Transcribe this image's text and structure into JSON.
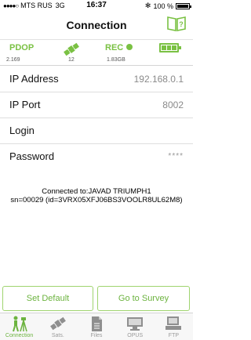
{
  "status_bar": {
    "carrier": "MTS RUS",
    "network": "3G",
    "time": "16:37",
    "battery": "100 %"
  },
  "nav": {
    "title": "Connection",
    "help_icon": "help-book-icon"
  },
  "gnss": {
    "pdop_label": "PDOP",
    "pdop_value": "2.169",
    "sats_value": "12",
    "rec_label": "REC",
    "rec_value": "1.83GB",
    "accent_color": "#7ac143"
  },
  "form": {
    "ip_address_label": "IP Address",
    "ip_address_value": "192.168.0.1",
    "ip_port_label": "IP Port",
    "ip_port_value": "8002",
    "login_label": "Login",
    "login_value": "",
    "password_label": "Password",
    "password_value": "****"
  },
  "connection": {
    "line1": "Connected to:JAVAD TRIUMPH1",
    "line2": "sn=00029 (id=3VRX05XFJ06BS3VOOLR8UL62M8)"
  },
  "buttons": {
    "set_default": "Set Default",
    "go_to_survey": "Go to Survey"
  },
  "tabs": [
    {
      "label": "Connection",
      "icon": "surveyor-tripod-icon",
      "active": true
    },
    {
      "label": "Sats.",
      "icon": "satellite-icon",
      "active": false
    },
    {
      "label": "Files",
      "icon": "file-icon",
      "active": false
    },
    {
      "label": "OPUS",
      "icon": "computer-icon",
      "active": false
    },
    {
      "label": "FTP",
      "icon": "computer-icon",
      "active": false
    }
  ]
}
